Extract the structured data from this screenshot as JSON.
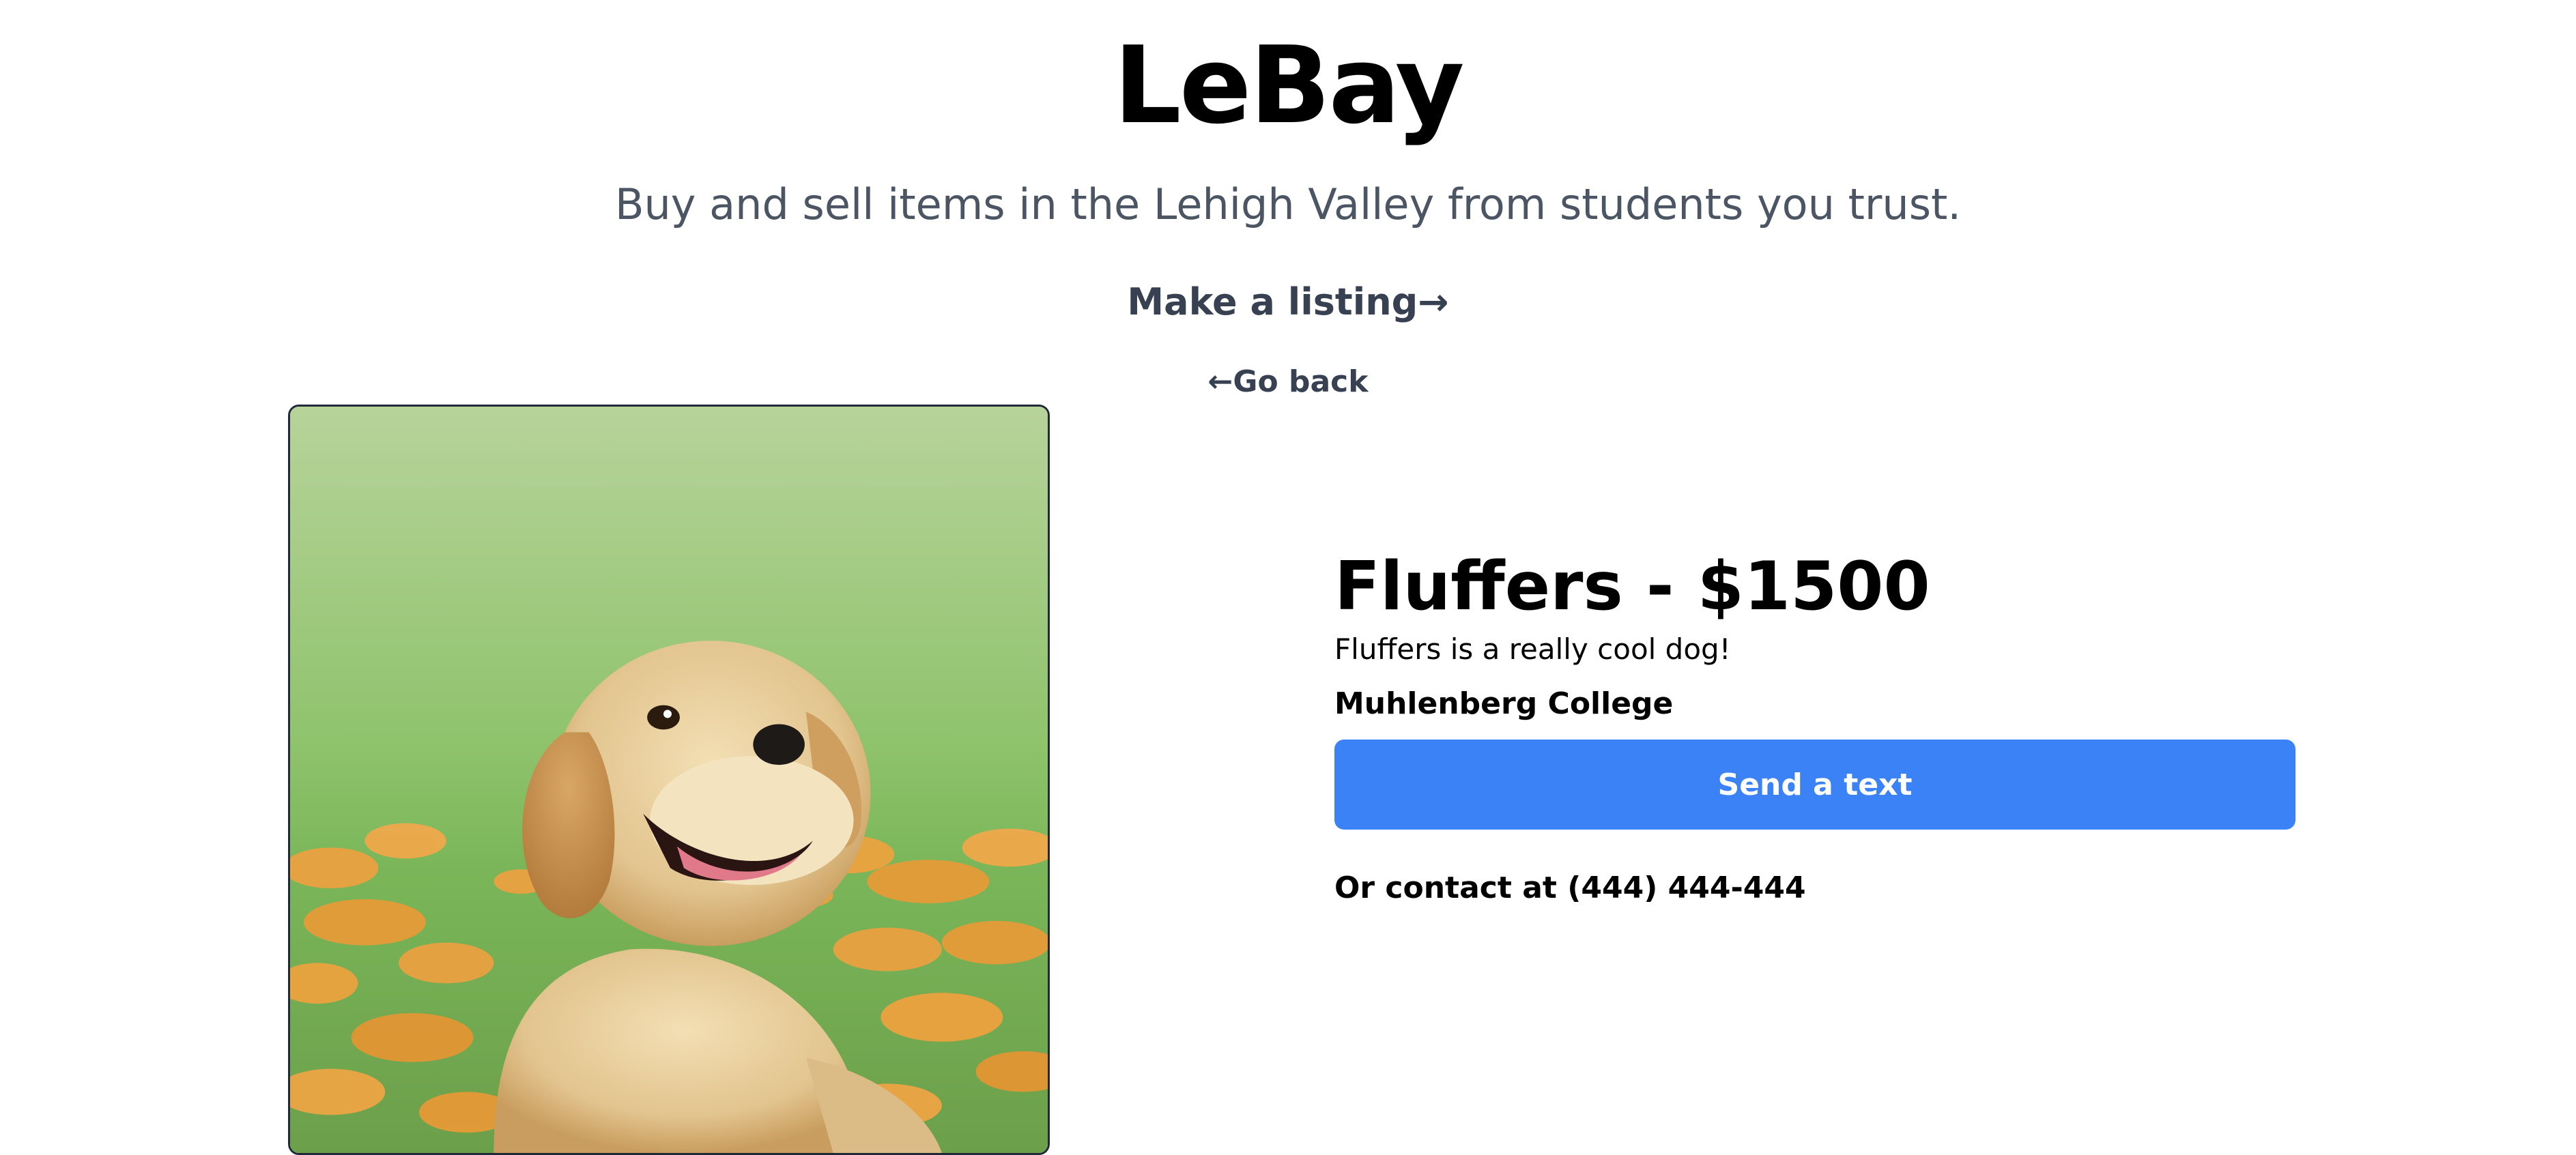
{
  "header": {
    "title": "LeBay",
    "tagline": "Buy and sell items in the Lehigh Valley from students you trust.",
    "make_listing_label": "Make a listing→",
    "go_back_label": "←Go back"
  },
  "listing": {
    "image": "golden-retriever-puppy-photo",
    "title": "Fluffers - $1500",
    "description": "Fluffers is a really cool dog!",
    "school": "Muhlenberg College",
    "send_text_label": "Send a text",
    "contact_text": "Or contact at (444) 444-444"
  },
  "colors": {
    "accent": "#3b82f6",
    "muted_text": "#4b5563",
    "link_text": "#374151"
  }
}
